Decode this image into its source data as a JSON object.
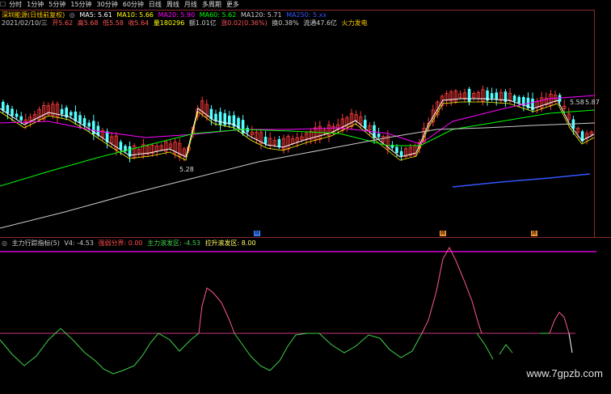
{
  "toolbar": {
    "icon": "chart-icon",
    "items": [
      "分时",
      "1分钟",
      "5分钟",
      "15分钟",
      "30分钟",
      "60分钟",
      "日线",
      "周线",
      "月线",
      "多周期",
      "更多"
    ]
  },
  "header": {
    "stock": "深圳能源(日线前复权)",
    "ma5_label": "MA5: 5.61",
    "ma10_label": "MA10: 5.66",
    "ma20_label": "MA20: 5.90",
    "ma60_label": "MA60: 5.62",
    "ma120_label": "MA120: 5.71",
    "ma250_label": "MA250: 5.xx",
    "date": "2021/02/10/三",
    "open_label": "开5.62",
    "high_label": "高5.68",
    "low_label": "低5.58",
    "close_label": "收5.64",
    "vol_label": "量180296",
    "amount_label": "额1.01亿",
    "change_label": "涨0.02(0.36%)",
    "turnover_label": "换0.38%",
    "float_label": "流通47.6亿",
    "sector": "火力发电"
  },
  "price_labels": {
    "low_mark": "5.28",
    "right_mark_a": "5.58",
    "right_mark_b": "5.87"
  },
  "markers": [
    "财",
    "腾",
    "腾"
  ],
  "indicator": {
    "title": "主力行踪指标(5)",
    "v4_label": "V4: -4.53",
    "line1_label": "强弱分界: 0.00",
    "line2_label": "主力滚发区: -4.53",
    "line3_label": "拉升滚发区: 8.00"
  },
  "colors": {
    "up": "#ff3b3b",
    "down": "#54ffff",
    "ma5": "#ffffff",
    "ma10": "#ffff00",
    "ma20": "#ff00ff",
    "ma60": "#00ff00",
    "ma120": "#cccccc",
    "ma250": "#3355ff",
    "ind_pink": "#ff5a8a",
    "ind_green": "#3fd24a",
    "ref_line": "#ff00ff"
  },
  "watermark": "www.7gpzb.com"
}
